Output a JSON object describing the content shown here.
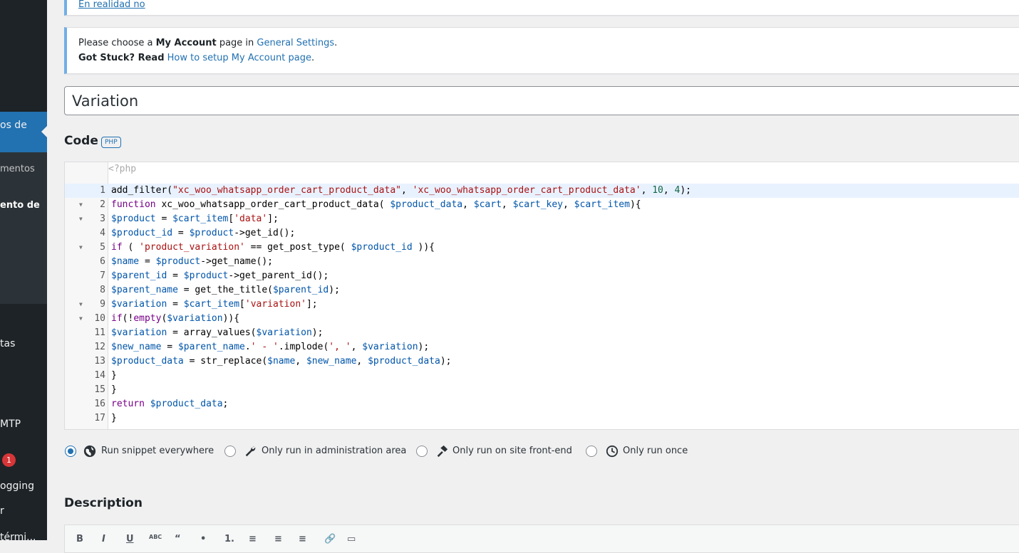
{
  "sidebar": {
    "items": [
      {
        "label": "os de"
      },
      {
        "label": "mentos"
      },
      {
        "label": "ento de"
      },
      {
        "label": "tas"
      },
      {
        "label": "MTP"
      },
      {
        "label": "ogging"
      },
      {
        "label": "r"
      },
      {
        "label": "térmi..."
      }
    ],
    "badge": "1"
  },
  "notices": {
    "top_link": "En realidad no",
    "account": {
      "choose_prefix": "Please choose a ",
      "choose_bold": "My Account",
      "choose_mid": " page in ",
      "choose_link": "General Settings",
      "choose_suffix": ".",
      "stuck_bold": "Got Stuck? Read",
      "stuck_link": "How to setup My Account page",
      "stuck_suffix": "."
    }
  },
  "snippet": {
    "title": "Variation",
    "code_heading": "Code",
    "language_badge": "PHP",
    "preface": "<?php",
    "lines": [
      "add_filter(\"xc_woo_whatsapp_order_cart_product_data\", 'xc_woo_whatsapp_order_cart_product_data', 10, 4);",
      "function xc_woo_whatsapp_order_cart_product_data( $product_data, $cart, $cart_key, $cart_item){",
      "$product = $cart_item['data'];",
      "$product_id = $product->get_id();",
      "if ( 'product_variation' == get_post_type( $product_id )){",
      "$name = $product->get_name();",
      "$parent_id = $product->get_parent_id();",
      "$parent_name = get_the_title($parent_id);",
      "$variation = $cart_item['variation'];",
      "if(!empty($variation)){",
      "$variation = array_values($variation);",
      "$new_name = $parent_name.' - '.implode(', ', $variation);",
      "$product_data = str_replace($name, $new_name, $product_data);",
      "}",
      "}",
      "return $product_data;",
      "}"
    ],
    "fold_lines": [
      2,
      3,
      5,
      9,
      10
    ]
  },
  "scope": {
    "options": [
      {
        "label": "Run snippet everywhere",
        "icon": "globe-icon",
        "checked": true
      },
      {
        "label": "Only run in administration area",
        "icon": "wrench-icon",
        "checked": false
      },
      {
        "label": "Only run on site front-end",
        "icon": "hammer-icon",
        "checked": false
      },
      {
        "label": "Only run once",
        "icon": "clock-icon",
        "checked": false
      }
    ]
  },
  "description": {
    "heading": "Description",
    "toolbar": [
      "B",
      "I",
      "U",
      "ABC",
      "“",
      "•",
      "1.",
      "≡",
      "≡",
      "≡",
      "🔗",
      "▭"
    ]
  },
  "colors": {
    "accent": "#2271b1",
    "sidebar": "#1d2327",
    "badge": "#d63638"
  }
}
